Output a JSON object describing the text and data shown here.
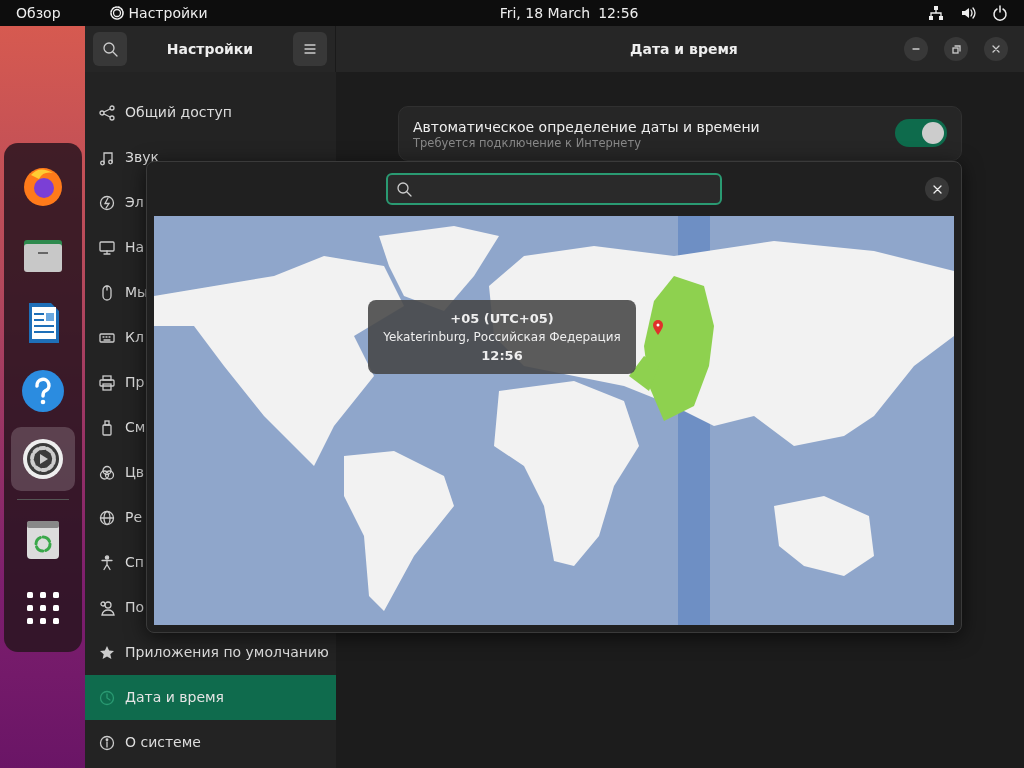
{
  "top_bar": {
    "activities": "Обзор",
    "app_menu": "Настройки",
    "date": "Fri, 18 March",
    "time": "12:56"
  },
  "dock": [
    {
      "kind": "browser",
      "selected": false
    },
    {
      "kind": "files",
      "selected": false
    },
    {
      "kind": "writer",
      "selected": false
    },
    {
      "kind": "help",
      "selected": false
    },
    {
      "kind": "settings",
      "selected": true
    },
    {
      "kind": "trash",
      "selected": false
    },
    {
      "kind": "apps",
      "selected": false
    }
  ],
  "window": {
    "sidebar_title": "Настройки",
    "title": "Дата и время"
  },
  "sidebar": {
    "items": [
      {
        "label": "Общий доступ",
        "kind": "share",
        "selected": false
      },
      {
        "label": "Звук",
        "kind": "music",
        "selected": false
      },
      {
        "label": "Эл",
        "kind": "power",
        "selected": false
      },
      {
        "label": "На",
        "kind": "display",
        "selected": false
      },
      {
        "label": "Мы",
        "kind": "mouse",
        "selected": false
      },
      {
        "label": "Кл",
        "kind": "keyboard",
        "selected": false
      },
      {
        "label": "Пр",
        "kind": "printer",
        "selected": false
      },
      {
        "label": "См",
        "kind": "usb",
        "selected": false
      },
      {
        "label": "Цв",
        "kind": "color",
        "selected": false
      },
      {
        "label": "Ре",
        "kind": "globe",
        "selected": false
      },
      {
        "label": "Сп",
        "kind": "person",
        "selected": false
      },
      {
        "label": "По",
        "kind": "users",
        "selected": false
      },
      {
        "label": "Приложения по умолчанию",
        "kind": "star",
        "selected": false
      },
      {
        "label": "Дата и время",
        "kind": "clock",
        "selected": true
      },
      {
        "label": "О системе",
        "kind": "info",
        "selected": false
      }
    ]
  },
  "content": {
    "auto_datetime": {
      "label": "Автоматическое определение даты и времени",
      "hint": "Требуется подключение к Интернету",
      "on": true
    }
  },
  "timezone_dialog": {
    "tooltip": {
      "zone": "+05 (UTC+05)",
      "place": "Yekaterinburg, Российская Федерация",
      "time": "12:56"
    }
  }
}
